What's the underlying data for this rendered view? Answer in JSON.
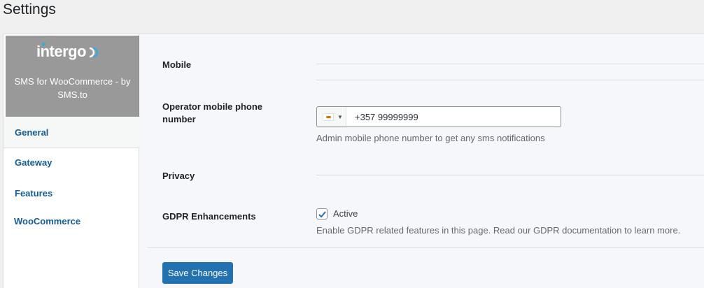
{
  "page": {
    "title": "Settings"
  },
  "brand": {
    "logo_text": "intergo",
    "tagline": "SMS for WooCommerce - by SMS.to"
  },
  "sidebar": {
    "items": [
      {
        "label": "General",
        "active": true
      },
      {
        "label": "Gateway",
        "active": false
      },
      {
        "label": "Features",
        "active": false
      },
      {
        "label": "WooCommerce",
        "active": false
      }
    ]
  },
  "sections": {
    "mobile": {
      "title": "Mobile"
    },
    "operator_phone": {
      "label": "Operator mobile phone number",
      "value": "+357 99999999",
      "description": "Admin mobile phone number to get any sms notifications",
      "flag_icon": "cyprus-flag-icon"
    },
    "privacy": {
      "title": "Privacy"
    },
    "gdpr": {
      "label": "GDPR Enhancements",
      "checkbox_label": "Active",
      "checked": true,
      "description": "Enable GDPR related features in this page. Read our GDPR documentation to learn more."
    }
  },
  "actions": {
    "save_label": "Save Changes"
  },
  "colors": {
    "accent": "#2271b1",
    "nav_link": "#135e96",
    "brand_bg": "#999999",
    "logo_accent": "#3aa8e0"
  }
}
